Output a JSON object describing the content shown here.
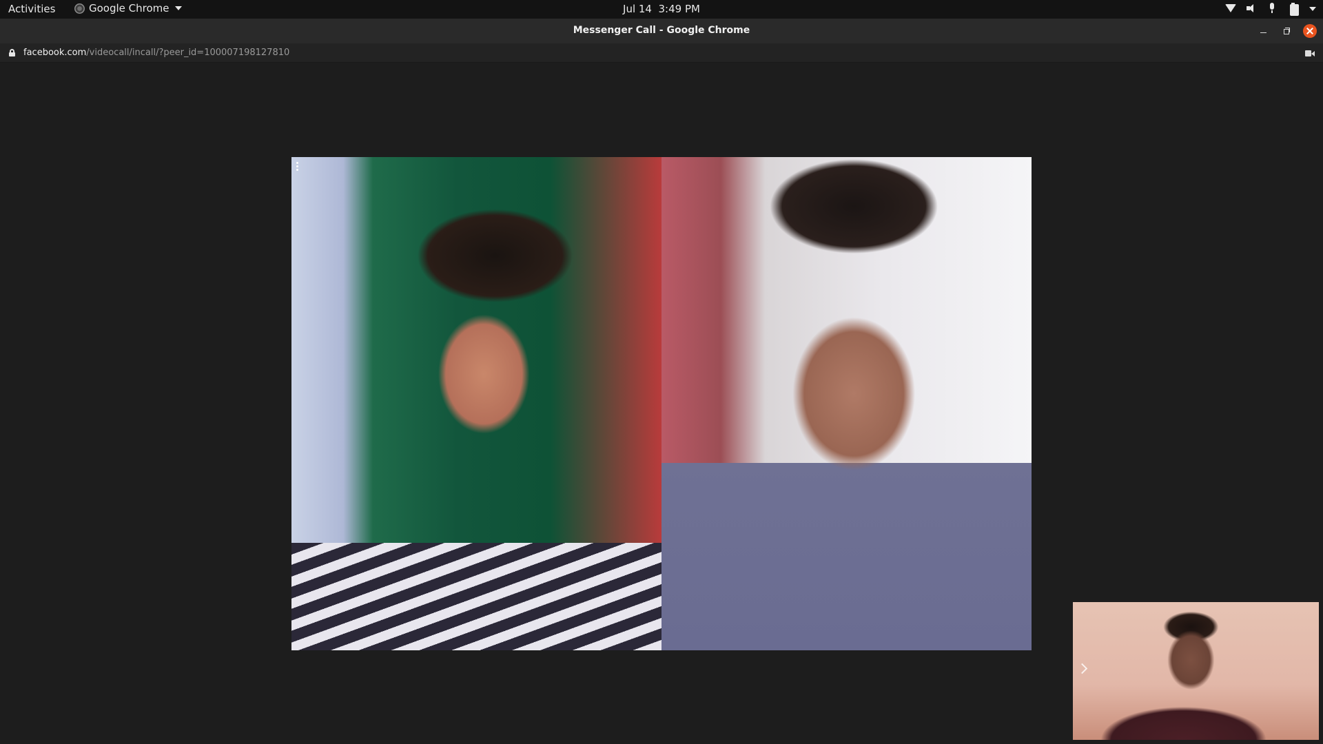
{
  "topbar": {
    "activities": "Activities",
    "app_name": "Google Chrome",
    "date": "Jul 14",
    "time": "3:49 PM"
  },
  "window": {
    "title": "Messenger Call - Google Chrome"
  },
  "address_bar": {
    "host": "facebook.com",
    "path": "/videocall/incall/?peer_id=100007198127810"
  },
  "call": {
    "participants": [
      {
        "role": "remote-video-left",
        "icon": "options-icon"
      },
      {
        "role": "remote-video-right"
      }
    ],
    "self_view": {
      "icon": "chevron-right-icon"
    }
  },
  "colors": {
    "topbar_bg": "#131313",
    "titlebar_bg": "#2a2a2a",
    "urlbar_bg": "#232323",
    "page_bg": "#1d1d1d",
    "close_button": "#e9541f"
  }
}
